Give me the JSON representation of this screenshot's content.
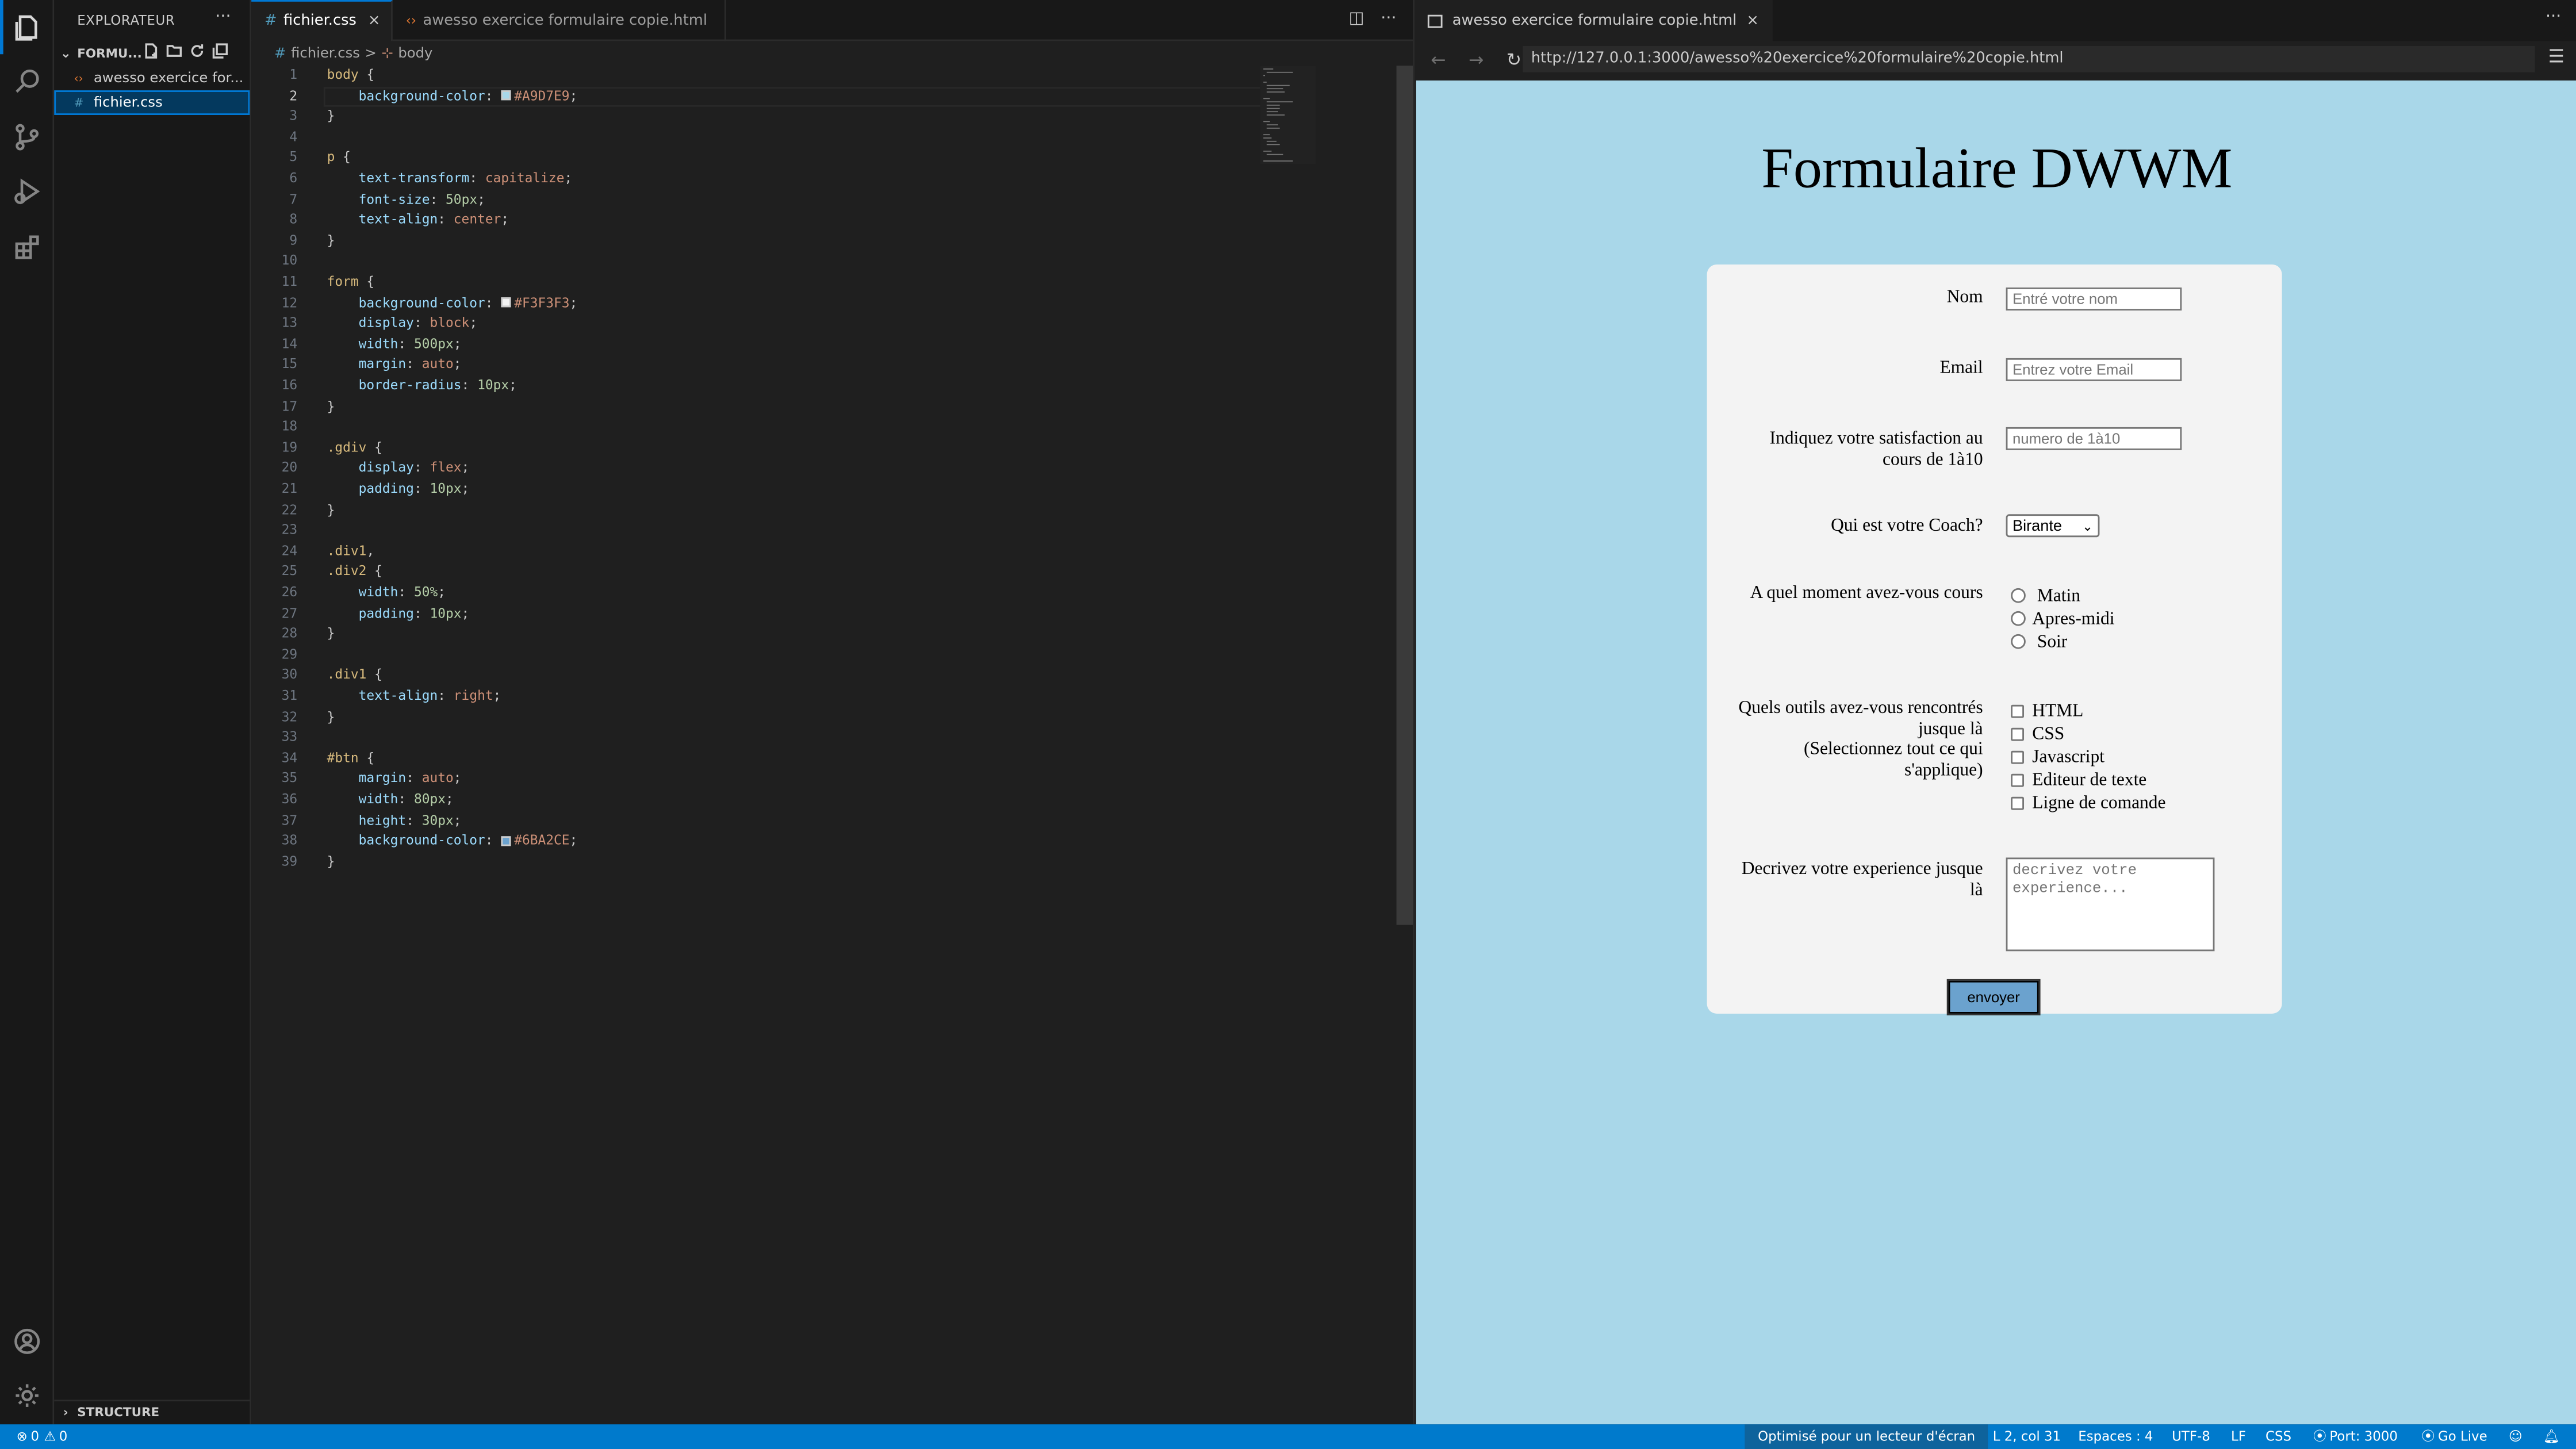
{
  "sidebar": {
    "title": "EXPLORATEUR",
    "more": "···",
    "folder": "FORMU...",
    "files": [
      {
        "icon": "‹›",
        "name": "awesso exercice for..."
      },
      {
        "icon": "#",
        "name": "fichier.css"
      }
    ],
    "structure": "STRUCTURE"
  },
  "editor": {
    "tabs": [
      {
        "icon": "#",
        "label": "fichier.css",
        "close": "×"
      },
      {
        "icon": "‹›",
        "label": "awesso exercice formulaire copie.html"
      }
    ],
    "breadcrumb": {
      "file": "fichier.css",
      "sep": ">",
      "symbol": "body"
    },
    "line_numbers": [
      "1",
      "2",
      "3",
      "4",
      "5",
      "6",
      "7",
      "8",
      "9",
      "10",
      "11",
      "12",
      "13",
      "14",
      "15",
      "16",
      "17",
      "18",
      "19",
      "20",
      "21",
      "22",
      "23",
      "24",
      "25",
      "26",
      "27",
      "28",
      "29",
      "30",
      "31",
      "32",
      "33",
      "34",
      "35",
      "36",
      "37",
      "38",
      "39"
    ],
    "swatch_colors": {
      "body": "#A9D7E9",
      "form": "#F3F3F3",
      "btn": "#6BA2CE"
    }
  },
  "browser": {
    "tab_label": "awesso exercice formulaire copie.html",
    "tab_close": "×",
    "url": "http://127.0.0.1:3000/awesso%20exercice%20formulaire%20copie.html",
    "page": {
      "title": "Formulaire DWWM",
      "nom_label": "Nom",
      "nom_placeholder": "Entré votre nom",
      "email_label": "Email",
      "email_placeholder": "Entrez votre Email",
      "satisfaction_label_1": "Indiquez votre satisfaction au",
      "satisfaction_label_2": "cours de 1à10",
      "satisfaction_placeholder": "numero de 1à10",
      "coach_label": "Qui est votre Coach?",
      "coach_selected": "Birante",
      "moment_label": "A quel moment avez-vous cours",
      "moments": [
        "Matin",
        "Apres-midi",
        "Soir"
      ],
      "outils_label_1": "Quels outils avez-vous rencontrés",
      "outils_label_2": "jusque là",
      "outils_label_3": "(Selectionnez tout ce qui",
      "outils_label_4": "s'applique)",
      "outils": [
        "HTML",
        "CSS",
        "Javascript",
        "Editeur de texte",
        "Ligne de comande"
      ],
      "experience_label_1": "Decrivez votre experience jusque",
      "experience_label_2": "là",
      "experience_placeholder": "decrivez votre\nexperience...",
      "submit_label": "envoyer"
    }
  },
  "status": {
    "errors": "0",
    "warnings": "0",
    "screen_reader": "Optimisé pour un lecteur d'écran",
    "position": "L 2, col 31",
    "spaces": "Espaces : 4",
    "encoding": "UTF-8",
    "eol": "LF",
    "language": "CSS",
    "port": "Port: 3000",
    "golive": "Go Live"
  }
}
